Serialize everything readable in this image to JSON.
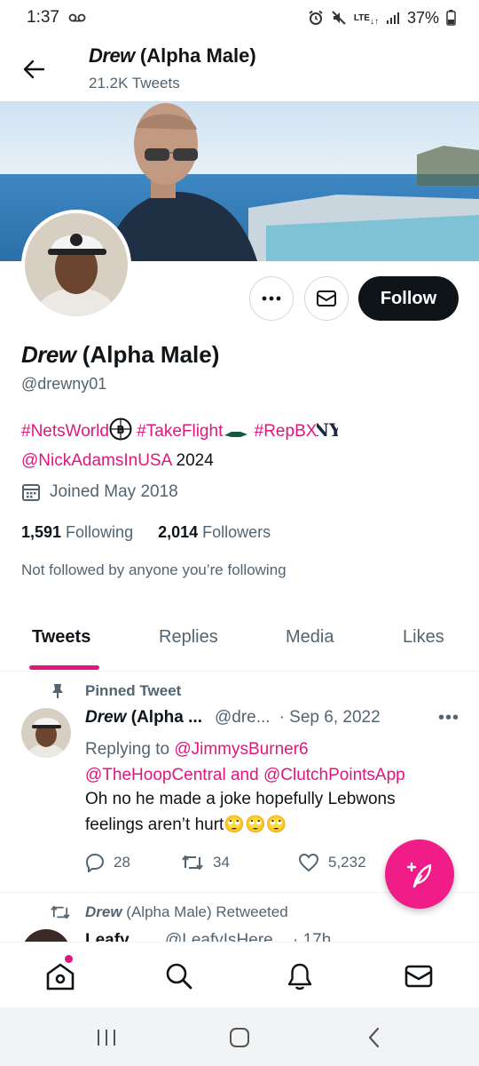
{
  "status_bar": {
    "time": "1:37",
    "battery": "37%",
    "network": "LTE"
  },
  "header": {
    "name_italic": "Drew",
    "name_rest": " (Alpha Male)",
    "tweet_count": "21.2K Tweets"
  },
  "profile": {
    "name_italic": "Drew",
    "name_rest": " (Alpha Male)",
    "handle": "@drewny01",
    "bio": {
      "tag1": "#NetsWorld",
      "tag2": "#TakeFlight",
      "tag3": "#RepBX",
      "mention": "@NickAdamsInUSA",
      "year": " 2024"
    },
    "joined": "Joined May 2018",
    "following_count": "1,591",
    "following_label": "Following",
    "followers_count": "2,014",
    "followers_label": "Followers",
    "not_followed": "Not followed by anyone you’re following"
  },
  "actions": {
    "follow_label": "Follow"
  },
  "tabs": [
    {
      "label": "Tweets",
      "active": true
    },
    {
      "label": "Replies"
    },
    {
      "label": "Media"
    },
    {
      "label": "Likes"
    }
  ],
  "pinned_tweet": {
    "pinned_label": "Pinned Tweet",
    "name_italic": "Drew",
    "name_rest": " (Alpha ...",
    "handle": "@dre...",
    "date": "· Sep 6, 2022",
    "replying_prefix": "Replying to ",
    "reply_user1": "@JimmysBurner6",
    "reply_user2": "@TheHoopCentral",
    "reply_and": " and ",
    "reply_user3": "@ClutchPointsApp",
    "text": "Oh no he made a joke hopefully Lebwons feelings aren’t hurt",
    "emoji": "🙄🙄🙄",
    "replies": "28",
    "retweets": "34",
    "likes": "5,232"
  },
  "retweet_row": {
    "name_italic": "Drew",
    "rest": " (Alpha Male) Retweeted"
  },
  "next_tweet": {
    "name": "Leafy",
    "handle": "@LeafyIsHere",
    "time": "· 17h"
  },
  "colors": {
    "accent": "#e0167e",
    "fab": "#f01c87",
    "text": "#0f1419",
    "muted": "#536471"
  }
}
